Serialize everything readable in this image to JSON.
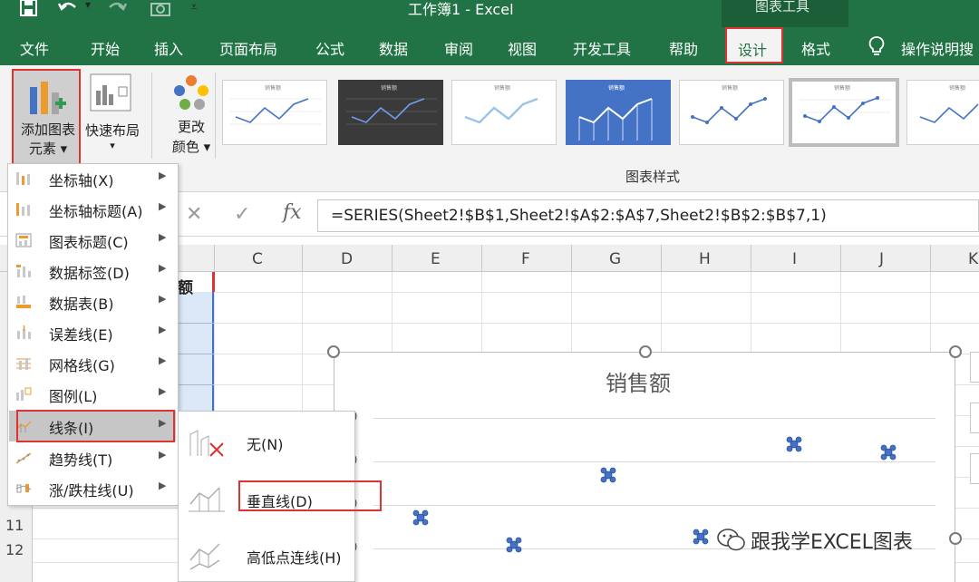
{
  "app": {
    "window_title": "工作簿1  -  Excel",
    "context_tab_group": "图表工具"
  },
  "menu": {
    "tabs": [
      "文件",
      "开始",
      "插入",
      "页面布局",
      "公式",
      "数据",
      "审阅",
      "视图",
      "开发工具",
      "帮助",
      "设计",
      "格式"
    ],
    "active_tab": "设计",
    "tell_me": "操作说明搜"
  },
  "ribbon": {
    "add_element": {
      "line1": "添加图表",
      "line2": "元素 ▾"
    },
    "quick_layout": {
      "label": "快速布局",
      "arrow": "▾"
    },
    "change_colors": {
      "line1": "更改",
      "line2": "颜色 ▾"
    },
    "chart_styles_group": "图表样式",
    "style_thumbs": [
      "销售额",
      "销售额",
      "销售额",
      "销售额",
      "销售额",
      "销售额",
      "销售额"
    ]
  },
  "formula_bar": {
    "cancel": "✕",
    "enter": "✓",
    "fx": "fx",
    "formula": "=SERIES(Sheet2!$B$1,Sheet2!$A$2:$A$7,Sheet2!$B$2:$B$7,1)"
  },
  "grid": {
    "column_headers": [
      "C",
      "D",
      "E",
      "F",
      "G",
      "H",
      "I",
      "J",
      "K"
    ],
    "row_headers": [
      "11",
      "12"
    ],
    "cell_b1": "额"
  },
  "chart": {
    "title": "销售额",
    "y_tick_labels": [
      "0",
      "0",
      "0",
      "0"
    ],
    "marker_color": "#4472c4"
  },
  "add_element_menu": {
    "items": [
      {
        "label": "坐标轴(X)",
        "icon": "axis-icon"
      },
      {
        "label": "坐标轴标题(A)",
        "icon": "axis-title-icon"
      },
      {
        "label": "图表标题(C)",
        "icon": "chart-title-icon"
      },
      {
        "label": "数据标签(D)",
        "icon": "data-labels-icon"
      },
      {
        "label": "数据表(B)",
        "icon": "data-table-icon"
      },
      {
        "label": "误差线(E)",
        "icon": "error-bars-icon"
      },
      {
        "label": "网格线(G)",
        "icon": "gridlines-icon"
      },
      {
        "label": "图例(L)",
        "icon": "legend-icon"
      },
      {
        "label": "线条(I)",
        "icon": "lines-icon"
      },
      {
        "label": "趋势线(T)",
        "icon": "trendline-icon"
      },
      {
        "label": "涨/跌柱线(U)",
        "icon": "up-down-bars-icon"
      }
    ],
    "highlighted": "线条(I)"
  },
  "lines_submenu": {
    "items": [
      {
        "label": "无(N)",
        "icon": "no-lines-icon"
      },
      {
        "label": "垂直线(D)",
        "icon": "drop-lines-icon"
      },
      {
        "label": "高低点连线(H)",
        "icon": "high-low-lines-icon"
      }
    ],
    "highlighted": "垂直线(D)"
  },
  "watermark": "跟我学EXCEL图表",
  "colors": {
    "excel_green": "#217346",
    "highlight_red": "#dd3333",
    "selection_blue": "#4472c4"
  }
}
